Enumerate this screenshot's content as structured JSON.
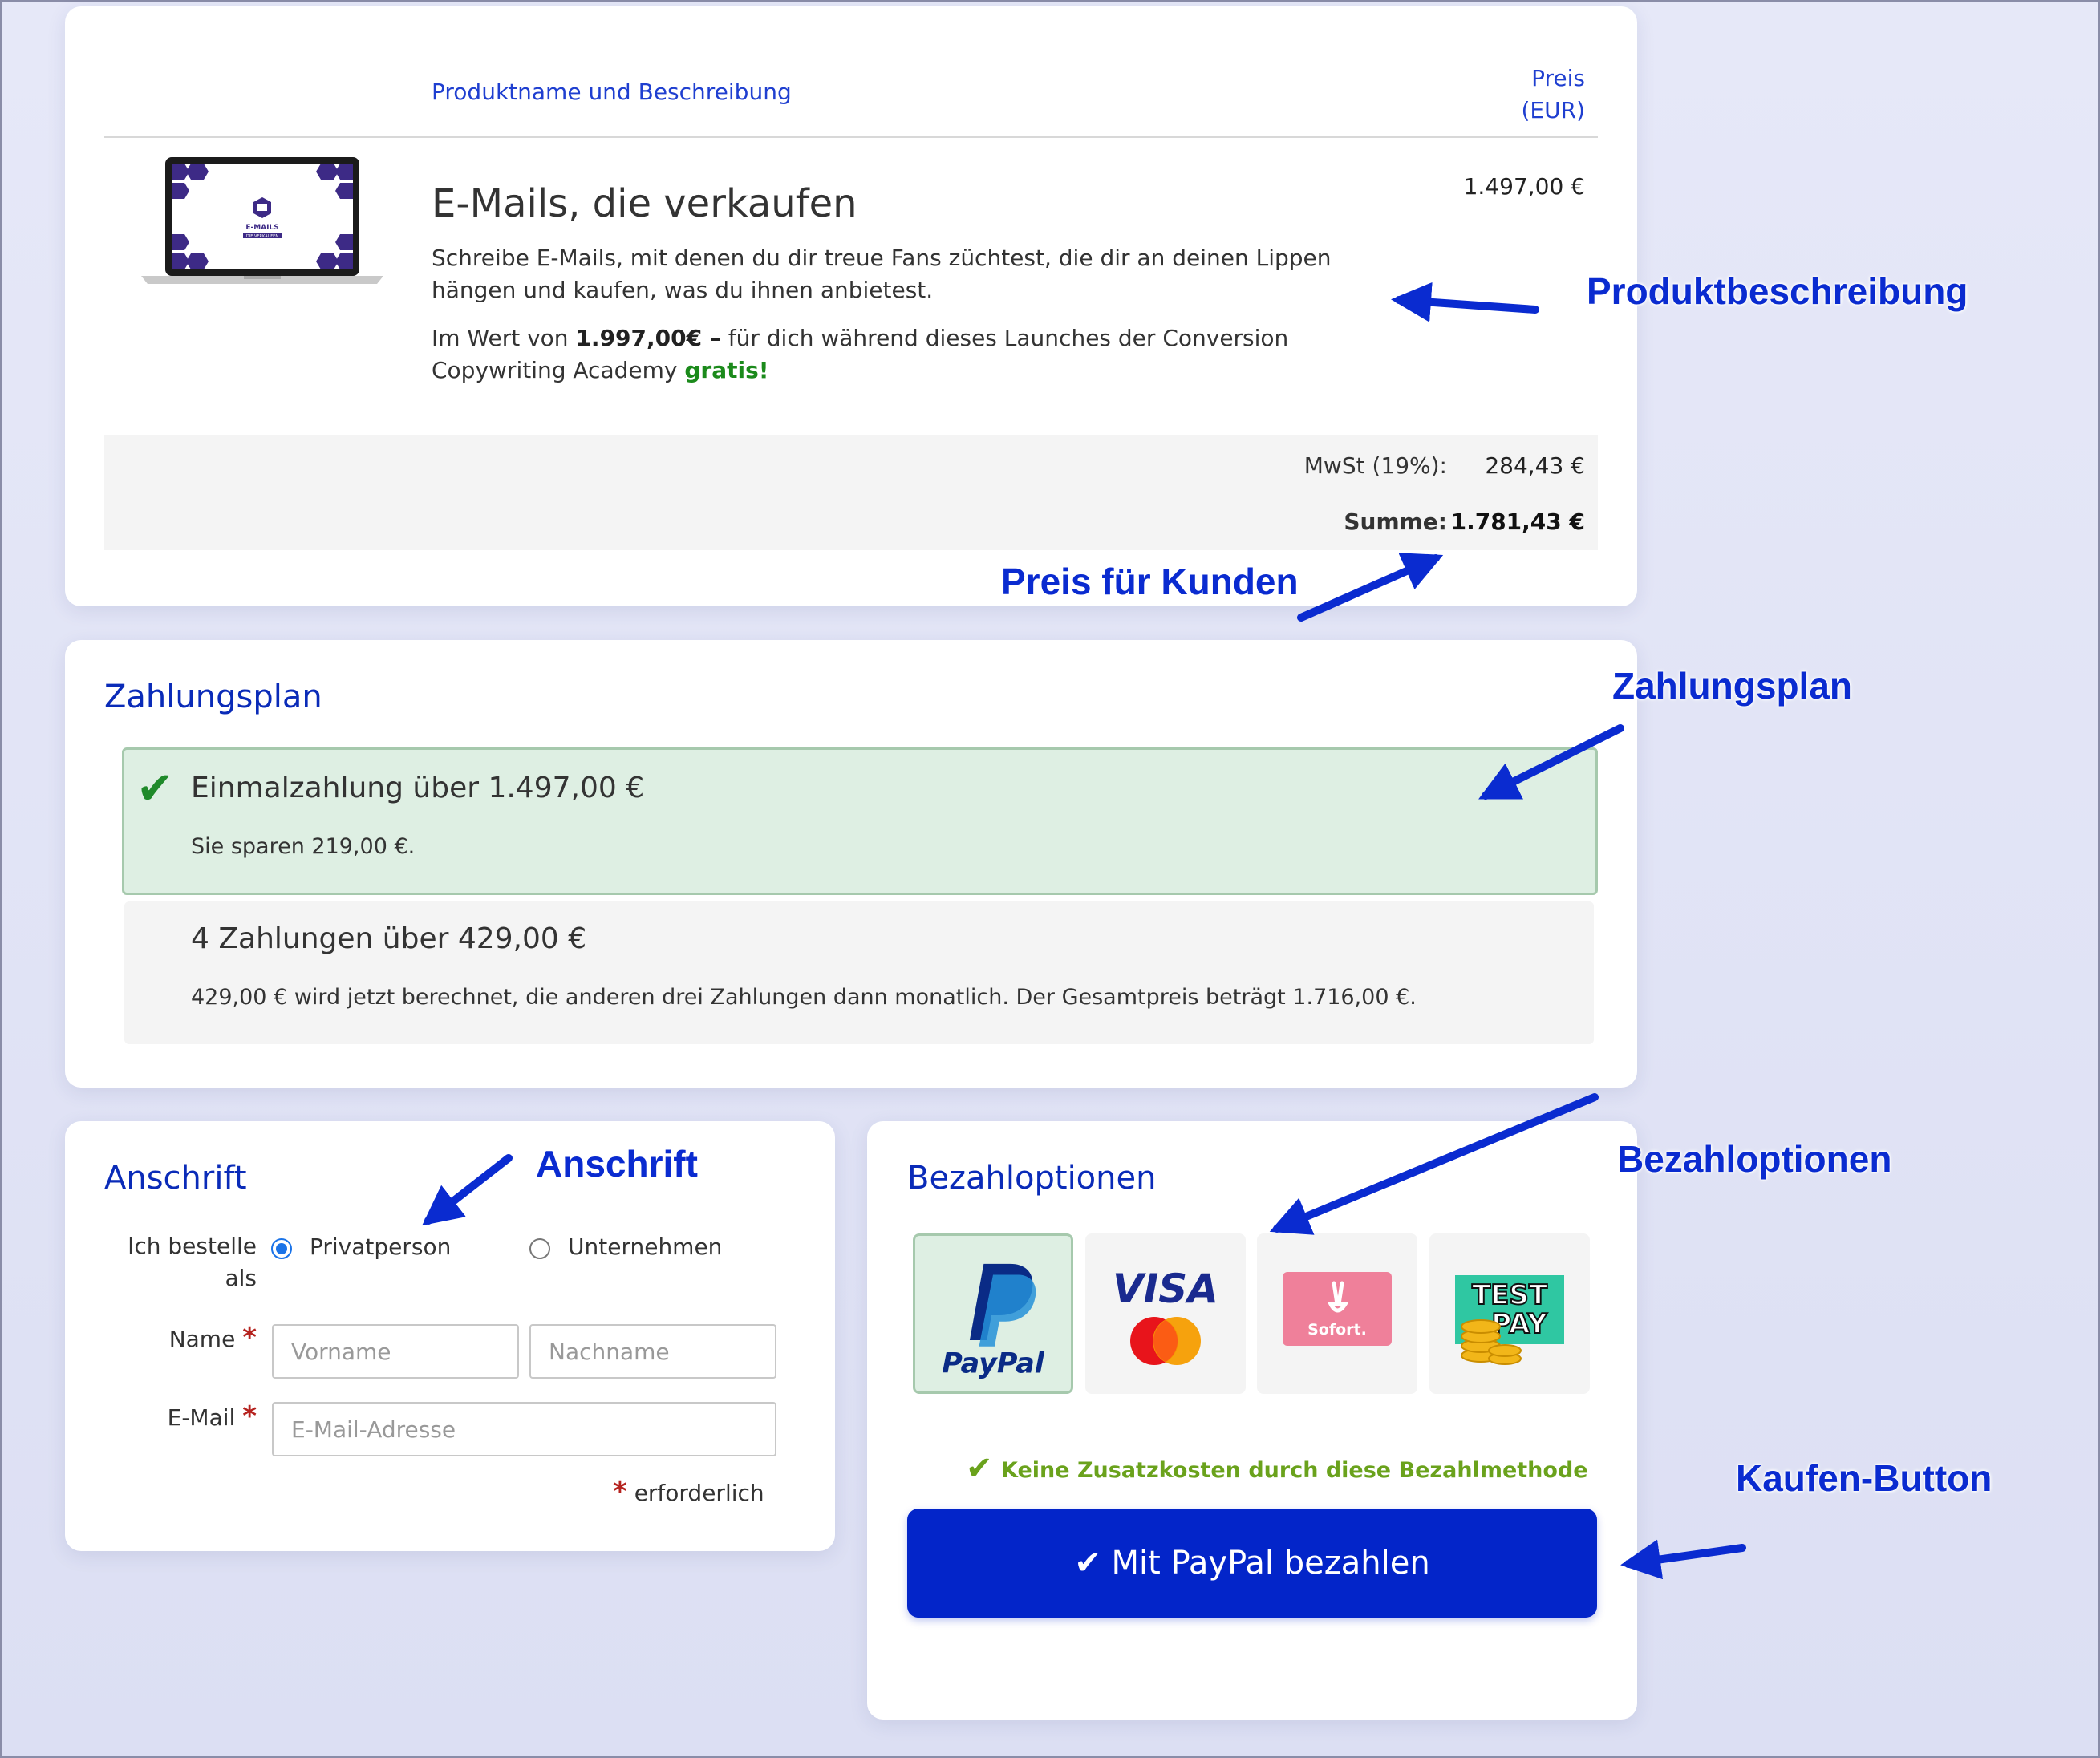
{
  "product_card": {
    "col_product": "Produktname und Beschreibung",
    "col_price_line1": "Preis",
    "col_price_line2": "(EUR)",
    "product_title": "E-Mails, die verkaufen",
    "description": "Schreibe E-Mails, mit denen du dir treue Fans züchtest, die dir an deinen Lippen hängen und kaufen, was du ihnen anbietest.",
    "value_prefix": "Im Wert von ",
    "value_amount": "1.997,00€ –",
    "value_middle": " für dich während dieses Launches der Conversion Copywriting Academy ",
    "value_gratis": "gratis!",
    "price": "1.497,00 €",
    "vat_label": "MwSt (19%):",
    "vat_value": "284,43 €",
    "sum_label": "Summe:",
    "sum_value": "1.781,43 €",
    "thumb_label": "E-MAILS",
    "thumb_sublabel": "DIE VERKAUFEN"
  },
  "payment_plan": {
    "title": "Zahlungsplan",
    "options": [
      {
        "title": "Einmalzahlung über 1.497,00 €",
        "subtitle": "Sie sparen 219,00 €.",
        "selected": true
      },
      {
        "title": "4 Zahlungen über 429,00 €",
        "subtitle": "429,00 € wird jetzt berechnet, die anderen drei Zahlungen dann monatlich. Der Gesamtpreis beträgt 1.716,00 €.",
        "selected": false
      }
    ]
  },
  "address": {
    "title": "Anschrift",
    "order_as_line1": "Ich bestelle",
    "order_as_line2": "als",
    "private_label": "Privatperson",
    "company_label": "Unternehmen",
    "name_label": "Name",
    "firstname_placeholder": "Vorname",
    "lastname_placeholder": "Nachname",
    "email_label": "E-Mail",
    "email_placeholder": "E-Mail-Adresse",
    "required_note": "erforderlich",
    "required_mark": "*"
  },
  "payment_options": {
    "title": "Bezahloptionen",
    "paypal_text": "PayPal",
    "visa_text": "VISA",
    "sofort_text": "Sofort.",
    "testpay_line1": "TEST",
    "testpay_line2": "PAY",
    "no_fee_note": "Keine Zusatzkosten durch diese Bezahlmethode",
    "buy_button": "✔ Mit PayPal bezahlen"
  },
  "annotations": {
    "product_desc": "Produktbeschreibung",
    "customer_price": "Preis für Kunden",
    "payment_plan": "Zahlungsplan",
    "address": "Anschrift",
    "payment_options": "Bezahloptionen",
    "buy_button": "Kaufen-Button"
  },
  "colors": {
    "accent_blue": "#0325c9",
    "link_blue": "#1f3fd0",
    "selected_green_bg": "#deefe3",
    "gratis_green": "#1b8a1b",
    "annotation_blue": "#0a2bd0"
  }
}
